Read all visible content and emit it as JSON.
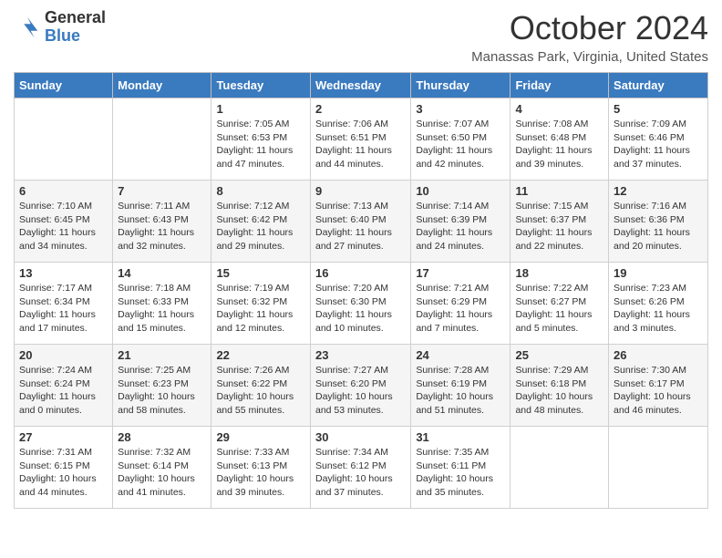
{
  "header": {
    "logo_general": "General",
    "logo_blue": "Blue",
    "month_title": "October 2024",
    "location": "Manassas Park, Virginia, United States"
  },
  "days_of_week": [
    "Sunday",
    "Monday",
    "Tuesday",
    "Wednesday",
    "Thursday",
    "Friday",
    "Saturday"
  ],
  "weeks": [
    [
      {
        "day": "",
        "info": ""
      },
      {
        "day": "",
        "info": ""
      },
      {
        "day": "1",
        "info": "Sunrise: 7:05 AM\nSunset: 6:53 PM\nDaylight: 11 hours and 47 minutes."
      },
      {
        "day": "2",
        "info": "Sunrise: 7:06 AM\nSunset: 6:51 PM\nDaylight: 11 hours and 44 minutes."
      },
      {
        "day": "3",
        "info": "Sunrise: 7:07 AM\nSunset: 6:50 PM\nDaylight: 11 hours and 42 minutes."
      },
      {
        "day": "4",
        "info": "Sunrise: 7:08 AM\nSunset: 6:48 PM\nDaylight: 11 hours and 39 minutes."
      },
      {
        "day": "5",
        "info": "Sunrise: 7:09 AM\nSunset: 6:46 PM\nDaylight: 11 hours and 37 minutes."
      }
    ],
    [
      {
        "day": "6",
        "info": "Sunrise: 7:10 AM\nSunset: 6:45 PM\nDaylight: 11 hours and 34 minutes."
      },
      {
        "day": "7",
        "info": "Sunrise: 7:11 AM\nSunset: 6:43 PM\nDaylight: 11 hours and 32 minutes."
      },
      {
        "day": "8",
        "info": "Sunrise: 7:12 AM\nSunset: 6:42 PM\nDaylight: 11 hours and 29 minutes."
      },
      {
        "day": "9",
        "info": "Sunrise: 7:13 AM\nSunset: 6:40 PM\nDaylight: 11 hours and 27 minutes."
      },
      {
        "day": "10",
        "info": "Sunrise: 7:14 AM\nSunset: 6:39 PM\nDaylight: 11 hours and 24 minutes."
      },
      {
        "day": "11",
        "info": "Sunrise: 7:15 AM\nSunset: 6:37 PM\nDaylight: 11 hours and 22 minutes."
      },
      {
        "day": "12",
        "info": "Sunrise: 7:16 AM\nSunset: 6:36 PM\nDaylight: 11 hours and 20 minutes."
      }
    ],
    [
      {
        "day": "13",
        "info": "Sunrise: 7:17 AM\nSunset: 6:34 PM\nDaylight: 11 hours and 17 minutes."
      },
      {
        "day": "14",
        "info": "Sunrise: 7:18 AM\nSunset: 6:33 PM\nDaylight: 11 hours and 15 minutes."
      },
      {
        "day": "15",
        "info": "Sunrise: 7:19 AM\nSunset: 6:32 PM\nDaylight: 11 hours and 12 minutes."
      },
      {
        "day": "16",
        "info": "Sunrise: 7:20 AM\nSunset: 6:30 PM\nDaylight: 11 hours and 10 minutes."
      },
      {
        "day": "17",
        "info": "Sunrise: 7:21 AM\nSunset: 6:29 PM\nDaylight: 11 hours and 7 minutes."
      },
      {
        "day": "18",
        "info": "Sunrise: 7:22 AM\nSunset: 6:27 PM\nDaylight: 11 hours and 5 minutes."
      },
      {
        "day": "19",
        "info": "Sunrise: 7:23 AM\nSunset: 6:26 PM\nDaylight: 11 hours and 3 minutes."
      }
    ],
    [
      {
        "day": "20",
        "info": "Sunrise: 7:24 AM\nSunset: 6:24 PM\nDaylight: 11 hours and 0 minutes."
      },
      {
        "day": "21",
        "info": "Sunrise: 7:25 AM\nSunset: 6:23 PM\nDaylight: 10 hours and 58 minutes."
      },
      {
        "day": "22",
        "info": "Sunrise: 7:26 AM\nSunset: 6:22 PM\nDaylight: 10 hours and 55 minutes."
      },
      {
        "day": "23",
        "info": "Sunrise: 7:27 AM\nSunset: 6:20 PM\nDaylight: 10 hours and 53 minutes."
      },
      {
        "day": "24",
        "info": "Sunrise: 7:28 AM\nSunset: 6:19 PM\nDaylight: 10 hours and 51 minutes."
      },
      {
        "day": "25",
        "info": "Sunrise: 7:29 AM\nSunset: 6:18 PM\nDaylight: 10 hours and 48 minutes."
      },
      {
        "day": "26",
        "info": "Sunrise: 7:30 AM\nSunset: 6:17 PM\nDaylight: 10 hours and 46 minutes."
      }
    ],
    [
      {
        "day": "27",
        "info": "Sunrise: 7:31 AM\nSunset: 6:15 PM\nDaylight: 10 hours and 44 minutes."
      },
      {
        "day": "28",
        "info": "Sunrise: 7:32 AM\nSunset: 6:14 PM\nDaylight: 10 hours and 41 minutes."
      },
      {
        "day": "29",
        "info": "Sunrise: 7:33 AM\nSunset: 6:13 PM\nDaylight: 10 hours and 39 minutes."
      },
      {
        "day": "30",
        "info": "Sunrise: 7:34 AM\nSunset: 6:12 PM\nDaylight: 10 hours and 37 minutes."
      },
      {
        "day": "31",
        "info": "Sunrise: 7:35 AM\nSunset: 6:11 PM\nDaylight: 10 hours and 35 minutes."
      },
      {
        "day": "",
        "info": ""
      },
      {
        "day": "",
        "info": ""
      }
    ]
  ]
}
